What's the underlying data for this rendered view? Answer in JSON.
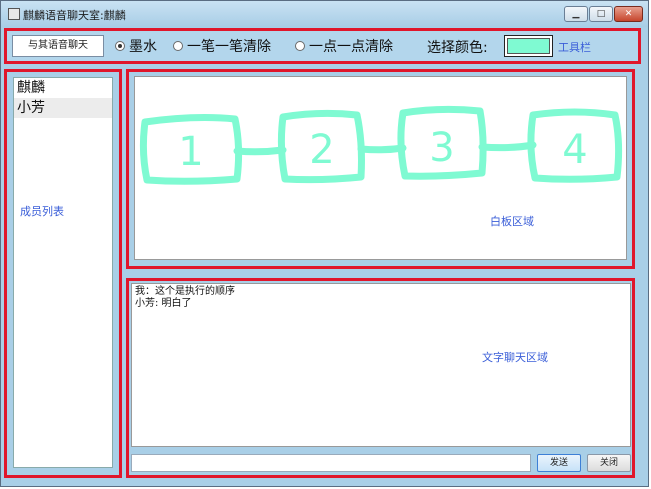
{
  "window": {
    "title": "麒麟语音聊天室:麒麟",
    "min_glyph": "▁",
    "max_glyph": "□",
    "close_glyph": "✕"
  },
  "toolbar": {
    "voice_button_label": "与其语音聊天",
    "modes": [
      {
        "label": "墨水",
        "selected": true
      },
      {
        "label": "一笔一笔清除",
        "selected": false
      },
      {
        "label": "一点一点清除",
        "selected": false
      }
    ],
    "color_label": "选择颜色:",
    "selected_color": "#7ffad2",
    "note": "工具栏"
  },
  "members": {
    "items": [
      {
        "name": "麒麟"
      },
      {
        "name": "小芳"
      }
    ],
    "selected_index": 1,
    "note": "成员列表"
  },
  "whiteboard": {
    "note": "白板区域",
    "stroke_color": "#7ffad2",
    "digits": [
      "1",
      "2",
      "3",
      "4"
    ]
  },
  "chat": {
    "messages": [
      "我：这个是执行的顺序",
      "小芳: 明白了"
    ],
    "note": "文字聊天区域",
    "input_value": "",
    "send_label": "发送",
    "close_label": "关闭"
  }
}
